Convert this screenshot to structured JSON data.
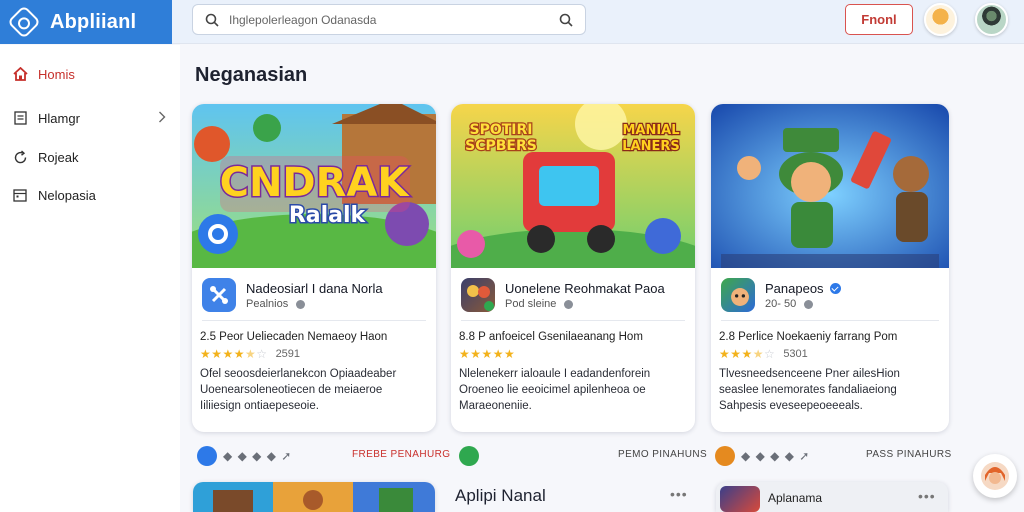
{
  "app": {
    "title": "Abpliianl"
  },
  "search": {
    "placeholder": "Ihglepolerleagon Odanasda"
  },
  "header": {
    "front_button": "Fnonl"
  },
  "sidebar": {
    "items": [
      {
        "label": "Homis",
        "icon": "home-icon",
        "active": true
      },
      {
        "label": "Hlamgr",
        "icon": "document-icon",
        "has_chevron": true
      },
      {
        "label": "Rojeak",
        "icon": "refresh-icon"
      },
      {
        "label": "Nelopasia",
        "icon": "calendar-icon"
      }
    ]
  },
  "main": {
    "title": "Neganasian",
    "cards": [
      {
        "banner_text": [
          "CNDRAK",
          "Ralalk"
        ],
        "name": "Nadeosiarl I dana Norla",
        "publisher": "Pealnios",
        "verified": false,
        "meta": "2.5 Peor Ueliecaden Nemaeoy Haon",
        "rating": 4.5,
        "rating_count": "2591",
        "description": "Ofel seoosdeierlanekcon Opiaadeaber Uoenearsoleneotiecen de meiaeroe Iiliiesign ontiaepeseoie.",
        "accent": "#2d79e8"
      },
      {
        "banner_text": [
          "SPOTIRI",
          "SCPBERS",
          "MANIAL",
          "LANERS"
        ],
        "name": "Uonelene Reohmakat Paoa",
        "publisher": "Pod sleine",
        "verified": false,
        "meta": "8.8 P anfoeicel Gsenilaeanang Hom",
        "rating": 5,
        "rating_count": "",
        "description": "Nlelenekerr ialoaule I eadandenforein Oroeneo lie eeoicimel apilenheoa oe Maraeoneniie.",
        "accent": "#2fa84f"
      },
      {
        "banner_text": [],
        "name": "Panapeos",
        "publisher": "20- 50",
        "verified": true,
        "meta": "2.8 Perlice Noekaeniy farrang Pom",
        "rating": 3.5,
        "rating_count": "5301",
        "description": "Tlvesneedsenceene Pner ailesHion seaslee lenemorates fandaliaeiong Sahpesis eveseepeoeeeals.",
        "accent": "#e58a1f"
      }
    ],
    "footer_links": [
      {
        "label": "FREBE PENAHURG",
        "color": "#c9302c"
      },
      {
        "label": "PEMO PINAHUNS",
        "color": "#444"
      },
      {
        "label": "PASS PINAHURS",
        "color": "#444"
      }
    ],
    "bottom": {
      "title": "Aplipi Nanal",
      "card_title": "Aplanama"
    }
  },
  "colors": {
    "brand": "#2f7ed8",
    "active": "#c6302b",
    "star": "#f3b21b"
  }
}
